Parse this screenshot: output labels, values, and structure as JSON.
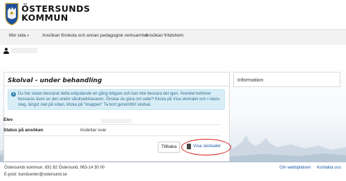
{
  "header": {
    "brand_line1": "ÖSTERSUNDS",
    "brand_line2": "KOMMUN"
  },
  "nav": {
    "items": [
      {
        "label": "Min sida",
        "caret": "▾"
      },
      {
        "label": "Ansökan förskola och annan pedagogisk verksamhet"
      },
      {
        "label": "Ansökan fritidshem"
      }
    ]
  },
  "main": {
    "title": "Skolval - under behandling",
    "alert": "Du har redan besvarat detta erbjudande en gång tidigare och kan inte besvara det igen. Ärendet behöver besvaras även av den andre vårdnadshavaren. Önskar du göra om valet? Klicka på Visa skolvalet och i nästa steg, längst ned på sidan, klicka på \"knappen\" Ta bort genomfört skolval.",
    "rows": [
      {
        "label": "Elev",
        "value": ""
      },
      {
        "label": "Status på ansökan",
        "value": "Inväntar svar"
      }
    ],
    "back_button": "Tillbaka",
    "view_button": "Visa skolvalet"
  },
  "info": {
    "title": "Information"
  },
  "footer": {
    "address": "Östersunds kommun, 831 82 Östersund, 063-14 30 00",
    "email": "E-post: kundcenter@ostersund.se",
    "link_about": "Om webbplatsen",
    "link_contact": "Kontakta oss"
  },
  "colors": {
    "alert_bg": "#d9edf7",
    "alert_text": "#31708f",
    "link": "#1a5aa8",
    "highlight_ring": "#d61a1a"
  }
}
